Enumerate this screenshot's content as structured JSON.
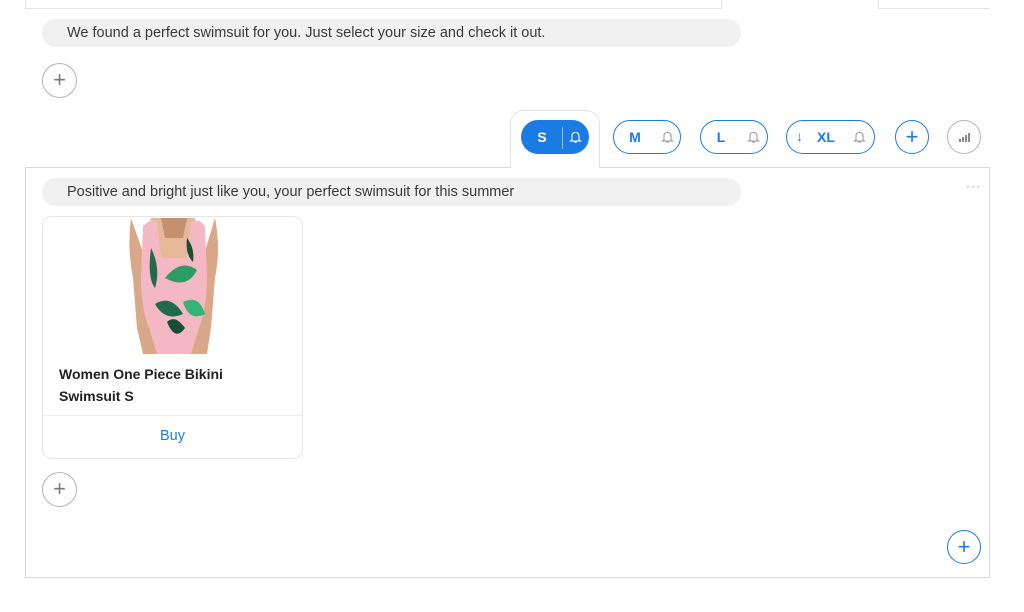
{
  "messages": {
    "intro": "We found a perfect swimsuit for you. Just select your size and check it out.",
    "panel": "Positive and bright just like you, your perfect swimsuit for this summer"
  },
  "size_options": [
    {
      "label": "S",
      "selected": true,
      "icon": "bell-icon"
    },
    {
      "label": "M",
      "selected": false,
      "icon": "bell-icon"
    },
    {
      "label": "L",
      "selected": false,
      "icon": "bell-icon"
    },
    {
      "label": "XL",
      "selected": false,
      "prefix_icon": "arrow-down-icon",
      "icon": "bell-icon"
    }
  ],
  "product": {
    "title": "Women One Piece Bikini Swimsuit  S",
    "buy_label": "Buy"
  },
  "icons": {
    "add": "+",
    "more": "···",
    "arrow_down": "↓"
  },
  "colors": {
    "accent": "#1a7be5",
    "bubble_bg": "#f0f0f0",
    "border": "#d9d9d9"
  }
}
